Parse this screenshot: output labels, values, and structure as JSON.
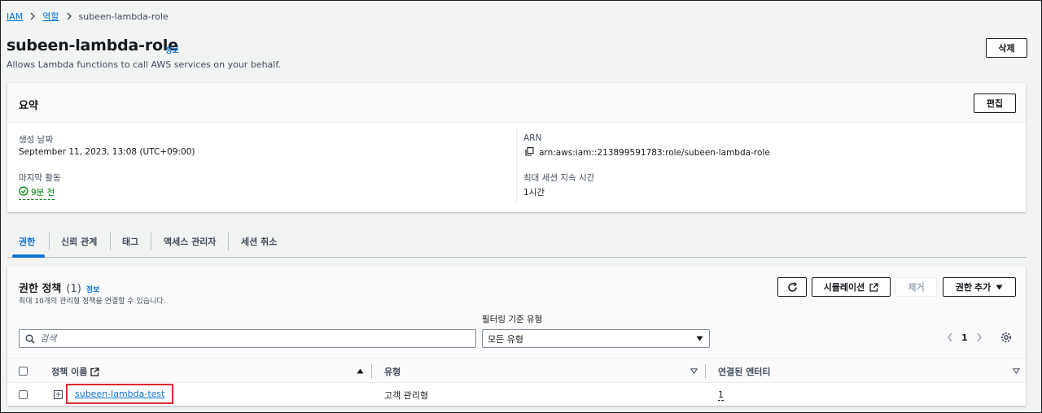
{
  "breadcrumb": {
    "items": [
      "IAM",
      "역할"
    ],
    "current": "subeen-lambda-role"
  },
  "header": {
    "title": "subeen-lambda-role",
    "info": "정보",
    "description": "Allows Lambda functions to call AWS services on your behalf.",
    "delete_label": "삭제"
  },
  "summary": {
    "title": "요약",
    "edit_label": "편집",
    "created_label": "생성 날짜",
    "created_value": "September 11, 2023, 13:08 (UTC+09:00)",
    "last_activity_label": "마지막 활동",
    "last_activity_value": "9분 전",
    "arn_label": "ARN",
    "arn_value": "arn:aws:iam::213899591783:role/subeen-lambda-role",
    "max_session_label": "최대 세션 지속 시간",
    "max_session_value": "1시간"
  },
  "tabs": [
    "권한",
    "신뢰 관계",
    "태그",
    "액세스 관리자",
    "세션 취소"
  ],
  "policies": {
    "title": "권한 정책",
    "count": "(1)",
    "info": "정보",
    "subtitle": "최대 10개의 관리형 정책을 연결할 수 있습니다.",
    "simulate_label": "시뮬레이션",
    "remove_label": "제거",
    "add_label": "권한 추가",
    "filter_label": "필터링 기준 유형",
    "search_placeholder": "검색",
    "filter_value": "모든 유형",
    "page": "1",
    "columns": [
      "정책 이름",
      "유형",
      "연결된 엔터티"
    ],
    "rows": [
      {
        "name": "subeen-lambda-test",
        "type": "고객 관리형",
        "entities": "1"
      }
    ]
  },
  "colors": {
    "link": "#0972d3",
    "success": "#037f0c",
    "highlight": "#e0262e"
  }
}
